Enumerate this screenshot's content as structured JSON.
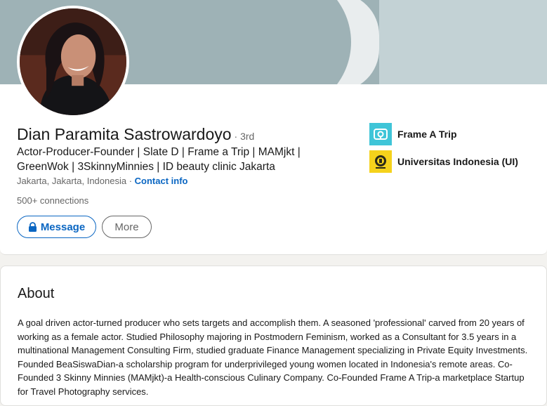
{
  "profile": {
    "name": "Dian Paramita Sastrowardoyo",
    "degree": "· 3rd",
    "headline": "Actor-Producer-Founder | Slate D | Frame a Trip | MAMjkt | GreenWok | 3SkinnyMinnies | ID beauty clinic Jakarta",
    "location": "Jakarta, Jakarta, Indonesia ·",
    "contact_info": "Contact info",
    "connections": "500+ connections",
    "avatar_icon": "profile-photo"
  },
  "actions": {
    "message_label": "Message",
    "more_label": "More"
  },
  "affiliations": [
    {
      "name": "Frame A Trip",
      "icon": "frame-a-trip-logo",
      "color": "#3fc5d8"
    },
    {
      "name": "Universitas Indonesia (UI)",
      "icon": "universitas-indonesia-logo",
      "color": "#f5d21c"
    }
  ],
  "about": {
    "title": "About",
    "text": "A goal driven actor-turned producer who sets targets and accomplish them. A seasoned 'professional' carved from 20 years of working as a female actor. Studied Philosophy majoring in Postmodern Feminism, worked as a Consultant for 3.5 years in a multinational Management Consulting Firm, studied graduate Finance Management specializing in Private Equity Investments. Founded BeaSiswaDian-a scholarship program for underprivileged young women located in Indonesia's remote areas. Co-Founded 3 Skinny Minnies (MAMjkt)-a Health-conscious Culinary Company. Co-Founded Frame A Trip-a marketplace Startup for Travel Photography services."
  },
  "colors": {
    "link": "#0a66c2",
    "banner": "#9eb2b6",
    "background": "#f3f2ef"
  }
}
